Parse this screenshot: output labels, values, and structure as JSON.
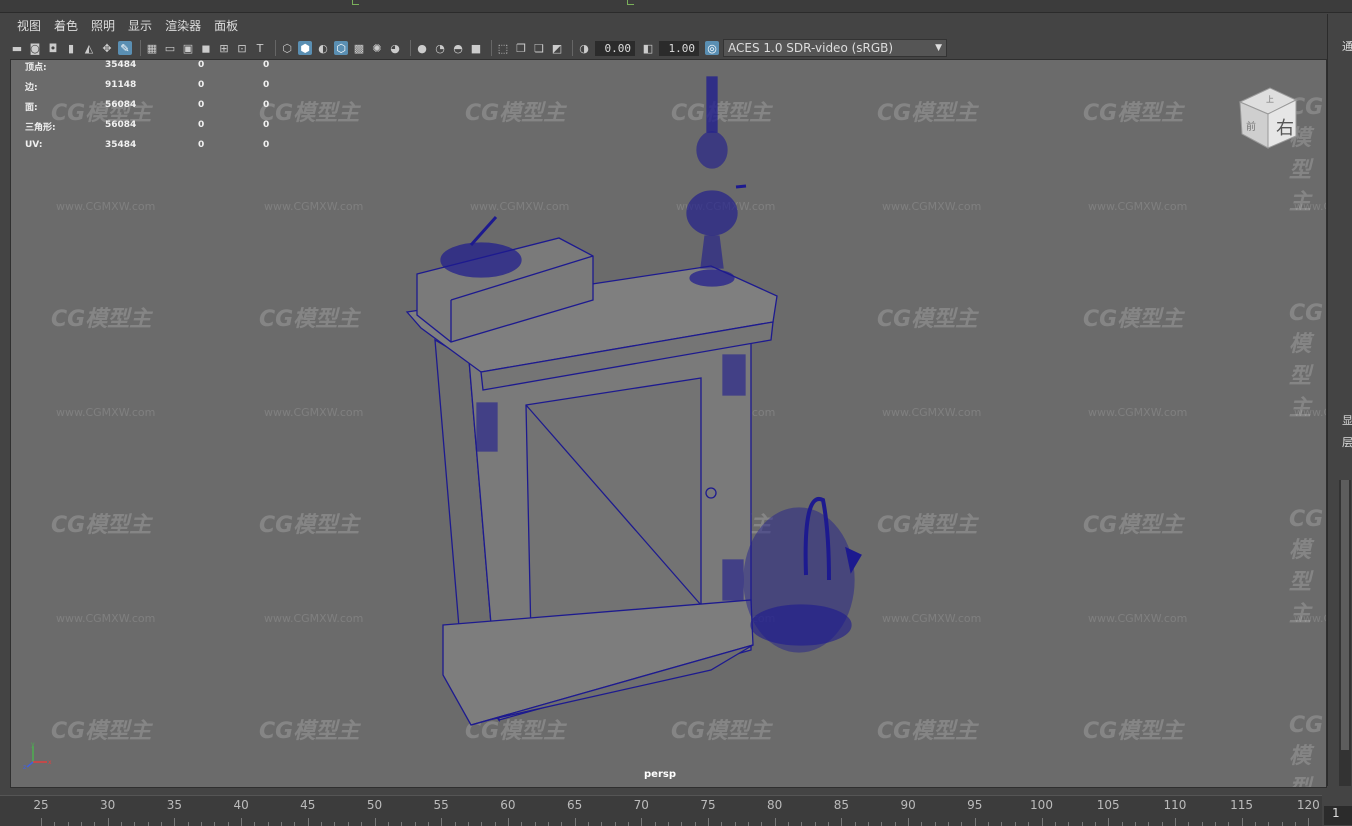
{
  "menu": [
    "视图",
    "着色",
    "照明",
    "显示",
    "渲染器",
    "面板"
  ],
  "toolbar": {
    "exposure_value": "0.00",
    "gamma_value": "1.00",
    "color_space": "ACES 1.0 SDR-video (sRGB)",
    "icons": [
      "select-camera-icon",
      "camera-attributes-icon",
      "bookmarks-icon",
      "image-plane-icon",
      "grid-icon",
      "film-gate-icon",
      "resolution-gate-icon",
      "gate-mask-icon",
      "field-chart-icon",
      "safe-action-icon",
      "safe-title-icon",
      "wireframe-icon",
      "smooth-shade-icon",
      "default-material-icon",
      "wireframe-on-shaded-icon",
      "textured-icon",
      "use-all-lights-icon",
      "shadows-icon",
      "screen-space-ao-icon",
      "motion-blur-icon",
      "anti-aliasing-icon",
      "depth-of-field-icon",
      "isolate-select-icon",
      "xray-icon",
      "xray-joints-icon",
      "xray-active-icon",
      "backface-culling-icon",
      "exposure-icon",
      "gamma-icon",
      "color-management-icon"
    ]
  },
  "hud": {
    "rows": [
      {
        "label": "顶点:",
        "total": "35484",
        "sel": "0",
        "tri": "0"
      },
      {
        "label": "边:",
        "total": "91148",
        "sel": "0",
        "tri": "0"
      },
      {
        "label": "面:",
        "total": "56084",
        "sel": "0",
        "tri": "0"
      },
      {
        "label": "三角形:",
        "total": "56084",
        "sel": "0",
        "tri": "0"
      },
      {
        "label": "UV:",
        "total": "35484",
        "sel": "0",
        "tri": "0"
      }
    ]
  },
  "viewcube": {
    "right": "右",
    "front": "前",
    "top": "上"
  },
  "camera_label": "persp",
  "watermark": {
    "logo": "CG模型主",
    "url": "www.CGMXW.com"
  },
  "right_panel": {
    "top": "通",
    "mid1": "显",
    "mid2": "层"
  },
  "timeline": {
    "ticks": [
      "25",
      "30",
      "35",
      "40",
      "45",
      "50",
      "55",
      "60",
      "65",
      "70",
      "75",
      "80",
      "85",
      "90",
      "95",
      "100",
      "105",
      "110",
      "115",
      "120"
    ],
    "current_frame": "1"
  },
  "axis": {
    "x": "x",
    "y": "y",
    "z": "z"
  },
  "colors": {
    "wire": "#1d1a8f",
    "viewport_bg": "#6b6b6b",
    "ui_bg": "#444444",
    "active_icon": "#5a8fb3"
  }
}
